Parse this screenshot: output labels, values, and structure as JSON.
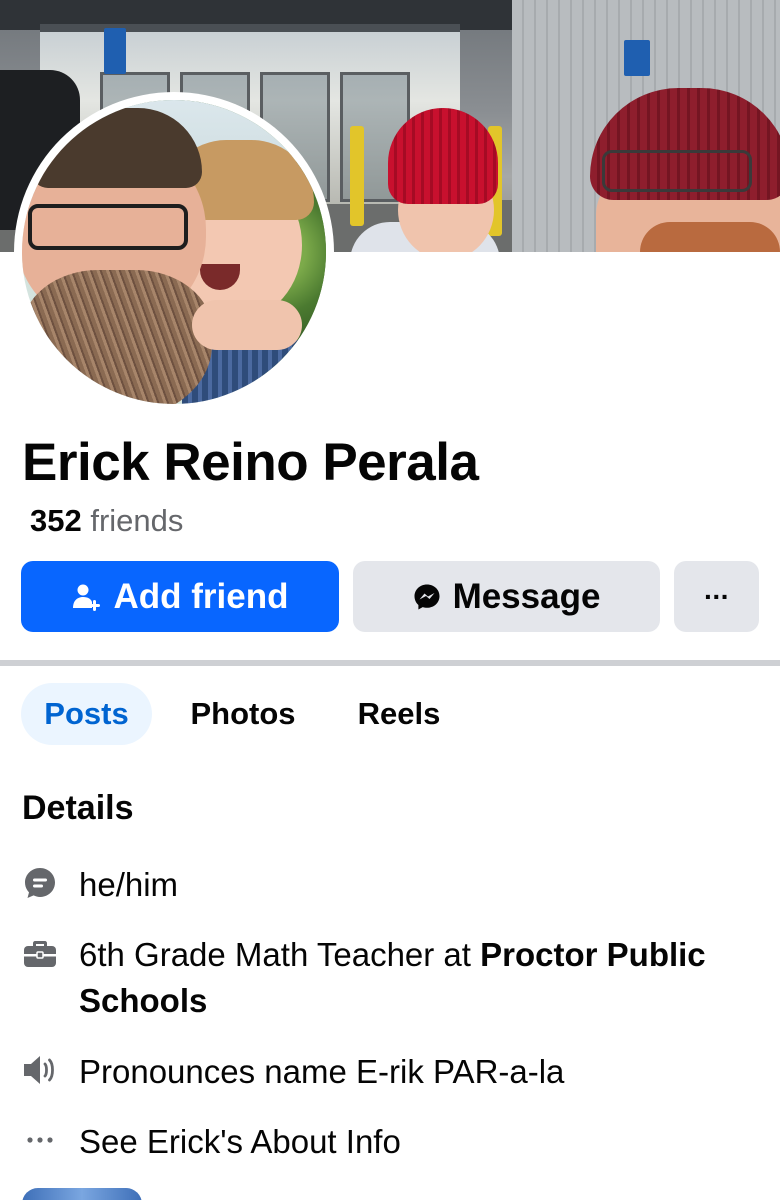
{
  "profile": {
    "name": "Erick Reino Perala",
    "friends_count": "352",
    "friends_label": "friends"
  },
  "actions": {
    "add_friend": "Add friend",
    "message": "Message",
    "more": "···"
  },
  "tabs": [
    {
      "label": "Posts",
      "active": true
    },
    {
      "label": "Photos",
      "active": false
    },
    {
      "label": "Reels",
      "active": false
    }
  ],
  "details": {
    "title": "Details",
    "items": [
      {
        "icon": "speech-bubble-icon",
        "text": "he/him"
      },
      {
        "icon": "briefcase-icon",
        "text_prefix": "6th Grade Math Teacher at ",
        "text_bold": "Proctor Public Schools"
      },
      {
        "icon": "speaker-icon",
        "text": "Pronounces name E-rik PAR-a-la"
      },
      {
        "icon": "more-dots-icon",
        "text": "See Erick's About Info"
      }
    ]
  },
  "colors": {
    "primary_blue": "#0866ff",
    "active_tab_bg": "#ebf5ff",
    "active_tab_text": "#0064d1",
    "secondary_button_bg": "#e4e6eb",
    "muted_text": "#65676b",
    "icon_gray": "#65676b"
  }
}
